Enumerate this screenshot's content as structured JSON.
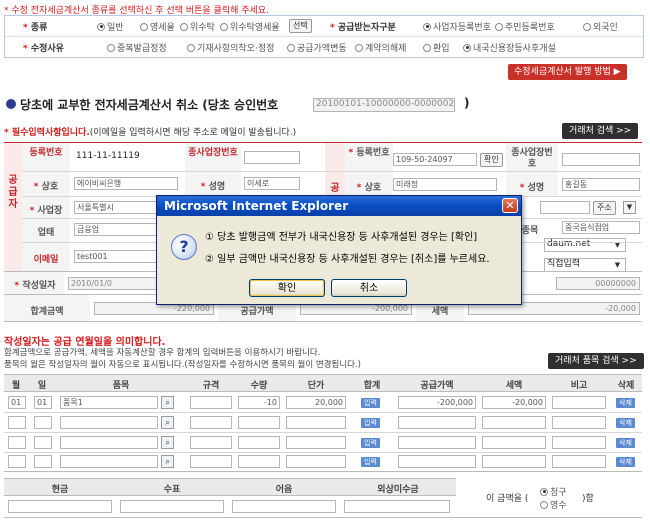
{
  "top_notice": "* 수정 전자세금계산서 종류를 선택하신 후 선택 버튼을 클릭해 주세요.",
  "options": {
    "type_label": "종류",
    "type_radios": [
      "일반",
      "영세율",
      "위수탁",
      "위수탁영세율"
    ],
    "type_selected": "일반",
    "select_button": "선택",
    "receiver_label": "공급받는자구분",
    "receiver_radios": [
      "사업자등록번호",
      "주민등록번호",
      "외국인"
    ],
    "receiver_selected": "사업자등록번호",
    "reason_label": "수정사유",
    "reason_radios": [
      "중복발급정정",
      "기재사항의착오·정정",
      "공급가액변동",
      "계약의해제",
      "환입",
      "내국신용장등사후개설"
    ],
    "reason_selected": "내국신용장등사후개설"
  },
  "method_button": "수정세금계산서 발행 방법 ▶",
  "title_prefix": "당초에 교부한 전자세금계산서 취소 (당초 승인번호",
  "title_value": "20100101-10000000-00000022",
  "title_suffix": ")",
  "required_note_bold": "* 필수입력사항입니다.",
  "required_note_rest": "(이메일을 입력하시면 해당 주소로 메일이 발송됩니다.)",
  "client_search_button": "거래처 검색 >>",
  "supplier": {
    "side": "공급자",
    "reg_label": "등록번호",
    "reg_value": "111-11-11119",
    "sub_label": "종사업장번호",
    "name_label": "상호",
    "name_value": "에이비씨은행",
    "rep_label": "성명",
    "rep_value": "이세로",
    "addr_label": "사업장",
    "addr_value": "서울특별시 ",
    "biz_label": "업태",
    "biz_value": "금융업",
    "email_label": "이메일",
    "email_value": "test001"
  },
  "receiver": {
    "side": "공",
    "reg_label": "등록번호",
    "reg_value": "109-50-24097",
    "confirm_button": "확인",
    "sub_label": "종사업장번호",
    "name_label": "상호",
    "name_value": "미래정",
    "rep_label": "성명",
    "rep_value": "홍길동",
    "addr_button": "주소",
    "item_label": "종목",
    "item_value": "중국음식점업",
    "email_domain": "daum.net",
    "direct_input": "직접입력",
    "serial_value": "00000000"
  },
  "write_date": {
    "label": "작성일자",
    "value": "2010/01/0"
  },
  "totals": {
    "total_label": "합계금액",
    "total_value": "-220,000",
    "supply_label": "공급가액",
    "supply_value": "-200,000",
    "tax_label": "세액",
    "tax_value": "-20,000"
  },
  "notes": {
    "red": "작성일자는 공급 연월일을 의미합니다.",
    "line1": "합계금액으로 공급가액, 세액을 자동계산할 경우 합계의 입력버튼을 이용하시기 바랍니다.",
    "line2": "품목의 월은 작성일자의 월이 자동으로 표시됩니다.(작성일자를 수정하시면 품목의 월이 변경됩니다.)"
  },
  "item_search_button": "거래처 품목 검색 >>",
  "item_table": {
    "headers": [
      "월",
      "일",
      "품목",
      "규격",
      "수량",
      "단가",
      "합계",
      "공급가액",
      "세액",
      "비고",
      "삭제"
    ],
    "rows": [
      {
        "month": "01",
        "day": "01",
        "item": "품목1",
        "qty": "-10",
        "price": "20,000",
        "supply": "-200,000",
        "tax": "-20,000"
      },
      {
        "month": "",
        "day": "",
        "item": "",
        "qty": "",
        "price": "",
        "supply": "",
        "tax": ""
      },
      {
        "month": "",
        "day": "",
        "item": "",
        "qty": "",
        "price": "",
        "supply": "",
        "tax": ""
      },
      {
        "month": "",
        "day": "",
        "item": "",
        "qty": "",
        "price": "",
        "supply": "",
        "tax": ""
      }
    ],
    "input_tag": "입력",
    "delete_tag": "삭제"
  },
  "payment": {
    "headers": [
      "현금",
      "수표",
      "어음",
      "외상미수금"
    ],
    "amount_text_pre": "이 금액을 (",
    "amount_text_post": ")함",
    "receipt": "영수",
    "claim": "청구",
    "selected": "청구"
  },
  "dialog": {
    "title": "Microsoft Internet Explorer",
    "line1": "① 당초 발행금액 전부가 내국신용장 등 사후개설된 경우는 [확인]",
    "line2": "② 일부 금액만 내국신용장 등 사후개설된 경우는 [취소]를 누르세요.",
    "ok": "확인",
    "cancel": "취소"
  }
}
